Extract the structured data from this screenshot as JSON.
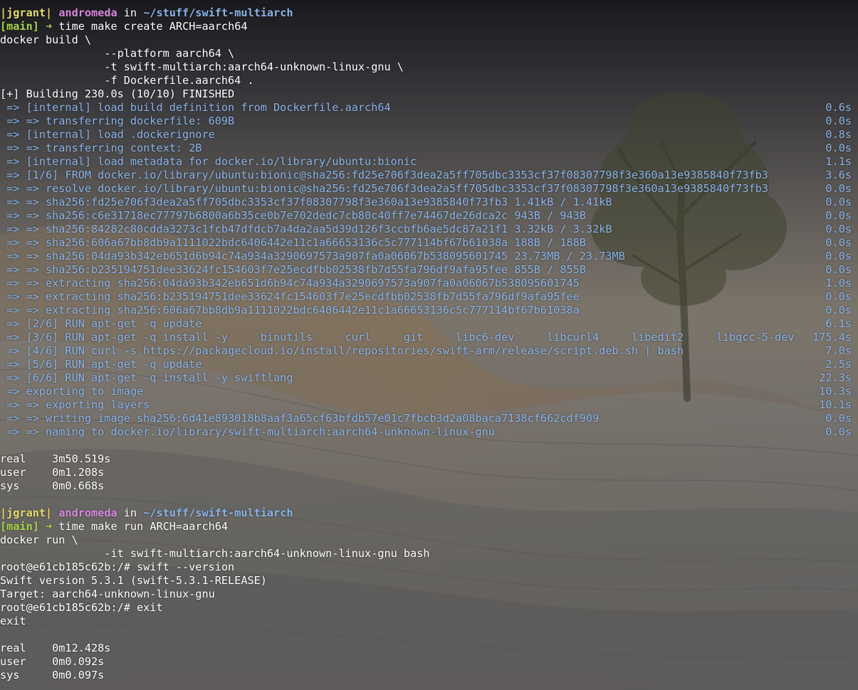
{
  "prompts": [
    {
      "user": "|jgrant|",
      "host": "andromeda",
      "in": " in ",
      "path": "~/stuff/swift-multiarch",
      "branch": "[main]",
      "arrow": "➜",
      "command": "time make create ARCH=aarch64"
    },
    {
      "user": "|jgrant|",
      "host": "andromeda",
      "in": " in ",
      "path": "~/stuff/swift-multiarch",
      "branch": "[main]",
      "arrow": "➜",
      "command": "time make run ARCH=aarch64"
    }
  ],
  "create_output": [
    "docker build \\",
    "                --platform aarch64 \\",
    "                -t swift-multiarch:aarch64-unknown-linux-gnu \\",
    "                -f Dockerfile.aarch64 .",
    "[+] Building 230.0s (10/10) FINISHED"
  ],
  "build_steps": [
    {
      "text": " => [internal] load build definition from Dockerfile.aarch64",
      "time": "0.6s"
    },
    {
      "text": " => => transferring dockerfile: 609B",
      "time": "0.0s"
    },
    {
      "text": " => [internal] load .dockerignore",
      "time": "0.8s"
    },
    {
      "text": " => => transferring context: 2B",
      "time": "0.0s"
    },
    {
      "text": " => [internal] load metadata for docker.io/library/ubuntu:bionic",
      "time": "1.1s"
    },
    {
      "text": " => [1/6] FROM docker.io/library/ubuntu:bionic@sha256:fd25e706f3dea2a5ff705dbc3353cf37f08307798f3e360a13e9385840f73fb3",
      "time": "3.6s"
    },
    {
      "text": " => => resolve docker.io/library/ubuntu:bionic@sha256:fd25e706f3dea2a5ff705dbc3353cf37f08307798f3e360a13e9385840f73fb3",
      "time": "0.0s"
    },
    {
      "text": " => => sha256:fd25e706f3dea2a5ff705dbc3353cf37f08307798f3e360a13e9385840f73fb3 1.41kB / 1.41kB",
      "time": "0.0s"
    },
    {
      "text": " => => sha256:c6e31718ec77797b6800a6b35ce0b7e702dedc7cb80c40ff7e74467de26dca2c 943B / 943B",
      "time": "0.0s"
    },
    {
      "text": " => => sha256:84282c80cdda3273c1fcb47dfdcb7a4da2aa5d39d126f3ccbfb6ae5dc87a21f1 3.32kB / 3.32kB",
      "time": "0.0s"
    },
    {
      "text": " => => sha256:606a67bb8db9a1111022bdc6406442e11c1a66653136c5c777114bf67b61038a 188B / 188B",
      "time": "0.0s"
    },
    {
      "text": " => => sha256:04da93b342eb651d6b94c74a934a3290697573a907fa0a06067b538095601745 23.73MB / 23.73MB",
      "time": "0.0s"
    },
    {
      "text": " => => sha256:b235194751dee33624fc154603f7e25ecdfbb02538fb7d55fa796df9afa95fee 855B / 855B",
      "time": "0.0s"
    },
    {
      "text": " => => extracting sha256:04da93b342eb651d6b94c74a934a3290697573a907fa0a06067b538095601745",
      "time": "1.0s"
    },
    {
      "text": " => => extracting sha256:b235194751dee33624fc154603f7e25ecdfbb02538fb7d55fa796df9afa95fee",
      "time": "0.0s"
    },
    {
      "text": " => => extracting sha256:606a67bb8db9a1111022bdc6406442e11c1a66653136c5c777114bf67b61038a",
      "time": "0.0s"
    },
    {
      "text": " => [2/6] RUN apt-get -q update",
      "time": "6.1s"
    },
    {
      "text": " => [3/6] RUN apt-get -q install -y     binutils     curl     git     libc6-dev     libcurl4     libedit2     libgcc-5-dev",
      "time": "175.4s"
    },
    {
      "text": " => [4/6] RUN curl -s https://packagecloud.io/install/repositories/swift-arm/release/script.deb.sh | bash",
      "time": "7.0s"
    },
    {
      "text": " => [5/6] RUN apt-get -q update",
      "time": "2.5s"
    },
    {
      "text": " => [6/6] RUN apt-get -q install -y swiftlang",
      "time": "22.3s"
    },
    {
      "text": " => exporting to image",
      "time": "10.3s"
    },
    {
      "text": " => => exporting layers",
      "time": "10.1s"
    },
    {
      "text": " => => writing image sha256:6d41e893018b8aaf3a65cf63bfdb57e01c7fbcb3d2a08baca7138cf662cdf909",
      "time": "0.0s"
    },
    {
      "text": " => => naming to docker.io/library/swift-multiarch:aarch64-unknown-linux-gnu",
      "time": "0.0s"
    }
  ],
  "create_timing": [
    "real    3m50.519s",
    "user    0m1.208s",
    "sys     0m0.668s"
  ],
  "run_output": [
    "docker run \\",
    "                -it swift-multiarch:aarch64-unknown-linux-gnu bash",
    "root@e61cb185c62b:/# swift --version",
    "Swift version 5.3.1 (swift-5.3.1-RELEASE)",
    "Target: aarch64-unknown-linux-gnu",
    "root@e61cb185c62b:/# exit",
    "exit"
  ],
  "run_timing": [
    "real    0m12.428s",
    "user    0m0.092s",
    "sys     0m0.097s"
  ],
  "colors": {
    "step_text": "#8bb4e8",
    "user": "#e6dc68",
    "host": "#d888e0",
    "path": "#8bb4e8",
    "branch": "#a6d84a"
  }
}
